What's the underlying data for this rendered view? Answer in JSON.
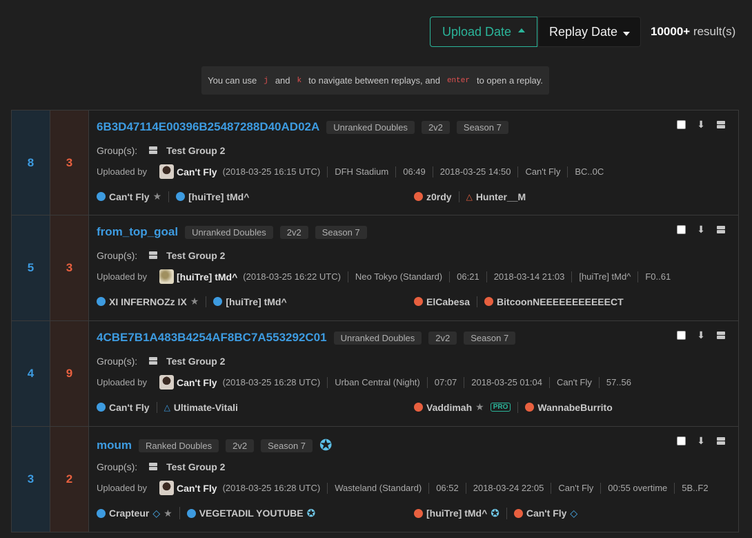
{
  "sort": {
    "upload_label": "Upload Date",
    "replay_label": "Replay Date",
    "result_count": "10000+",
    "result_suffix": "result(s)"
  },
  "hint": {
    "prefix": "You can use",
    "key1": "j",
    "and": "and",
    "key2": "k",
    "middle": "to navigate between replays, and",
    "key3": "enter",
    "suffix": "to open a replay."
  },
  "replays": [
    {
      "blue_score": "8",
      "orange_score": "3",
      "title": "6B3D47114E00396B25487288D40AD02A",
      "playlist": "Unranked Doubles",
      "mode": "2v2",
      "season": "Season 7",
      "group_label": "Group(s):",
      "group": "Test Group 2",
      "uploaded_by": "Uploaded by",
      "uploader": "Can't Fly",
      "upload_time": "(2018-03-25 16:15 UTC)",
      "map": "DFH Stadium",
      "duration": "06:49",
      "date": "2018-03-25 14:50",
      "recorder": "Can't Fly",
      "id_short": "BC..0C",
      "blue": [
        {
          "name": "Can't Fly",
          "platform": "steam",
          "badge": "star"
        },
        {
          "name": "[huiTre] tMd^",
          "platform": "steam",
          "badge": ""
        }
      ],
      "orange": [
        {
          "name": "z0rdy",
          "platform": "steam",
          "badge": ""
        },
        {
          "name": "Hunter__M",
          "platform": "ps",
          "badge": ""
        }
      ]
    },
    {
      "blue_score": "5",
      "orange_score": "3",
      "title": "from_top_goal",
      "playlist": "Unranked Doubles",
      "mode": "2v2",
      "season": "Season 7",
      "group_label": "Group(s):",
      "group": "Test Group 2",
      "uploaded_by": "Uploaded by",
      "uploader": "[huiTre] tMd^",
      "upload_time": "(2018-03-25 16:22 UTC)",
      "map": "Neo Tokyo (Standard)",
      "duration": "06:21",
      "date": "2018-03-14 21:03",
      "recorder": "[huiTre] tMd^",
      "id_short": "F0..61",
      "blue": [
        {
          "name": "XI INFERNOZz IX",
          "platform": "xbox",
          "badge": "star"
        },
        {
          "name": "[huiTre] tMd^",
          "platform": "steam",
          "badge": ""
        }
      ],
      "orange": [
        {
          "name": "ElCabesa",
          "platform": "steam",
          "badge": ""
        },
        {
          "name": "BitcoonNEEEEEEEEEEECT",
          "platform": "steam",
          "badge": ""
        }
      ]
    },
    {
      "blue_score": "4",
      "orange_score": "9",
      "title": "4CBE7B1A483B4254AF8BC7A553292C01",
      "playlist": "Unranked Doubles",
      "mode": "2v2",
      "season": "Season 7",
      "group_label": "Group(s):",
      "group": "Test Group 2",
      "uploaded_by": "Uploaded by",
      "uploader": "Can't Fly",
      "upload_time": "(2018-03-25 16:28 UTC)",
      "map": "Urban Central (Night)",
      "duration": "07:07",
      "date": "2018-03-25 01:04",
      "recorder": "Can't Fly",
      "id_short": "57..56",
      "blue": [
        {
          "name": "Can't Fly",
          "platform": "steam",
          "badge": ""
        },
        {
          "name": "Ultimate-Vitali",
          "platform": "ps",
          "badge": ""
        }
      ],
      "orange": [
        {
          "name": "Vaddimah",
          "platform": "steam",
          "badge": "star-pro",
          "pro_label": "PRO"
        },
        {
          "name": "WannabeBurrito",
          "platform": "steam",
          "badge": ""
        }
      ]
    },
    {
      "blue_score": "3",
      "orange_score": "2",
      "title": "moum",
      "playlist": "Ranked Doubles",
      "mode": "2v2",
      "season": "Season 7",
      "group_label": "Group(s):",
      "group": "Test Group 2",
      "uploaded_by": "Uploaded by",
      "uploader": "Can't Fly",
      "upload_time": "(2018-03-25 16:28 UTC)",
      "map": "Wasteland (Standard)",
      "duration": "06:52",
      "date": "2018-03-24 22:05",
      "recorder": "Can't Fly",
      "overtime": "00:55 overtime",
      "id_short": "5B..F2",
      "blue": [
        {
          "name": "Crapteur",
          "platform": "steam",
          "badge": "diamond-star"
        },
        {
          "name": "VEGETADIL YOUTUBE",
          "platform": "steam",
          "badge": "champ"
        }
      ],
      "orange": [
        {
          "name": "[huiTre] tMd^",
          "platform": "steam",
          "badge": "champ"
        },
        {
          "name": "Can't Fly",
          "platform": "steam",
          "badge": "diamond"
        }
      ]
    }
  ]
}
